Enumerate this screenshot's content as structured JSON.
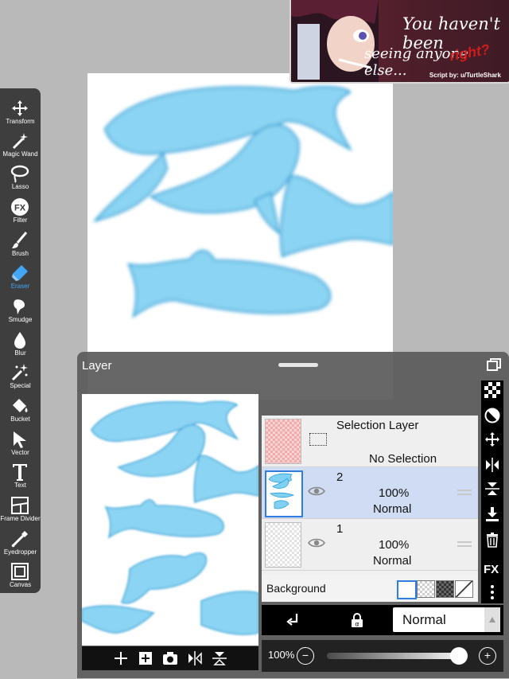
{
  "ad": {
    "line1": "You haven't been",
    "line2": "seeing anyone else...",
    "tag": "right?",
    "credit": "Script by: u/TurtleShark"
  },
  "toolbar": {
    "tools": [
      {
        "label": "Transform",
        "icon": "move-arrows-icon"
      },
      {
        "label": "Magic Wand",
        "icon": "magic-wand-icon"
      },
      {
        "label": "Lasso",
        "icon": "lasso-icon"
      },
      {
        "label": "Filter",
        "icon": "fx-filter-icon"
      },
      {
        "label": "Brush",
        "icon": "brush-icon"
      },
      {
        "label": "Eraser",
        "icon": "eraser-icon",
        "active": true
      },
      {
        "label": "Smudge",
        "icon": "smudge-icon"
      },
      {
        "label": "Blur",
        "icon": "blur-drop-icon"
      },
      {
        "label": "Special",
        "icon": "special-sparkle-icon"
      },
      {
        "label": "Bucket",
        "icon": "bucket-icon"
      },
      {
        "label": "Vector",
        "icon": "vector-cursor-icon"
      },
      {
        "label": "Text",
        "icon": "text-t-icon"
      },
      {
        "label": "Frame Divider",
        "icon": "frame-divider-icon"
      },
      {
        "label": "Eyedropper",
        "icon": "eyedropper-icon"
      },
      {
        "label": "Canvas",
        "icon": "canvas-icon"
      }
    ]
  },
  "layer_panel": {
    "title": "Layer",
    "selection_layer": {
      "name": "Selection Layer",
      "status": "No Selection"
    },
    "layers": [
      {
        "name": "2",
        "opacity": "100%",
        "blend": "Normal",
        "selected": true
      },
      {
        "name": "1",
        "opacity": "100%",
        "blend": "Normal",
        "selected": false
      }
    ],
    "background_label": "Background",
    "blend_mode": "Normal",
    "opacity_value": "100%",
    "opacity_fraction": 1.0,
    "right_icons": [
      "checker-icon",
      "invert-icon",
      "move-layer-icon",
      "flip-horizontal-icon",
      "flip-vertical-icon",
      "merge-down-icon",
      "trash-icon",
      "fx-label",
      "more-vertical-icon"
    ],
    "fx_label": "FX"
  },
  "colors": {
    "shark_blue": "#3fb3e6",
    "selected_row": "#cfdcf3",
    "panel_bg": "#5a5a5a",
    "active_tool": "#42a5f5"
  }
}
